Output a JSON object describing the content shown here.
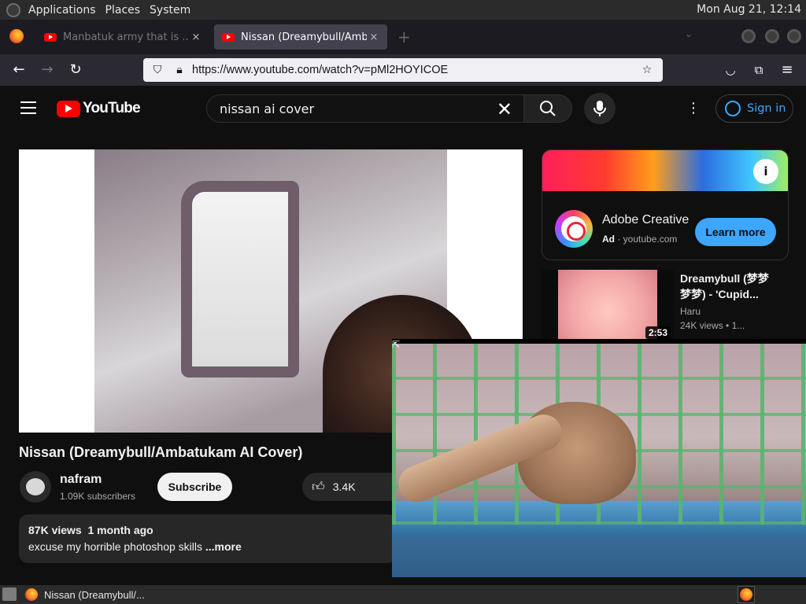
{
  "topbar": {
    "menus": [
      "Applications",
      "Places",
      "System"
    ],
    "clock": "Mon Aug 21, 12:14"
  },
  "tabs": [
    {
      "label": "Manbatuk army that is ...",
      "active": false
    },
    {
      "label": "Nissan (Dreamybull/Ambatukam AI Cover)",
      "active": true
    }
  ],
  "browser": {
    "url": "https://www.youtube.com/watch?v=pMl2HOYICOE",
    "new_tab_symbol": "+"
  },
  "youtube": {
    "logo_text": "YouTube",
    "search_query": "nissan ai cover",
    "sign_in_label": "Sign in"
  },
  "video": {
    "title": "Nissan (Dreamybull/Ambatukam AI Cover)",
    "channel": "nafram",
    "subscribers": "1.09K subscribers",
    "subscribe_label": "Subscribe",
    "likes": "3.4K",
    "views": "87K views",
    "age": "1 month ago",
    "description": "excuse my horrible photoshop skills ",
    "more_label": "...more"
  },
  "ad": {
    "title": "Adobe Creative Cloud",
    "badge": "Ad",
    "domain": "youtube.com",
    "cta": "Learn more",
    "info_icon": "i"
  },
  "recommendation": {
    "title": "Dreamybull (梦梦梦梦) - 'Cupid...",
    "channel": "Haru",
    "views": "24K views",
    "age_partial": " • 1...",
    "duration": "2:53"
  },
  "taskbar": {
    "window_label": "Nissan (Dreamybull/..."
  },
  "colors": {
    "yt_red": "#ff0000",
    "link_blue": "#3ea6ff",
    "page_bg": "#0f0f0f"
  }
}
